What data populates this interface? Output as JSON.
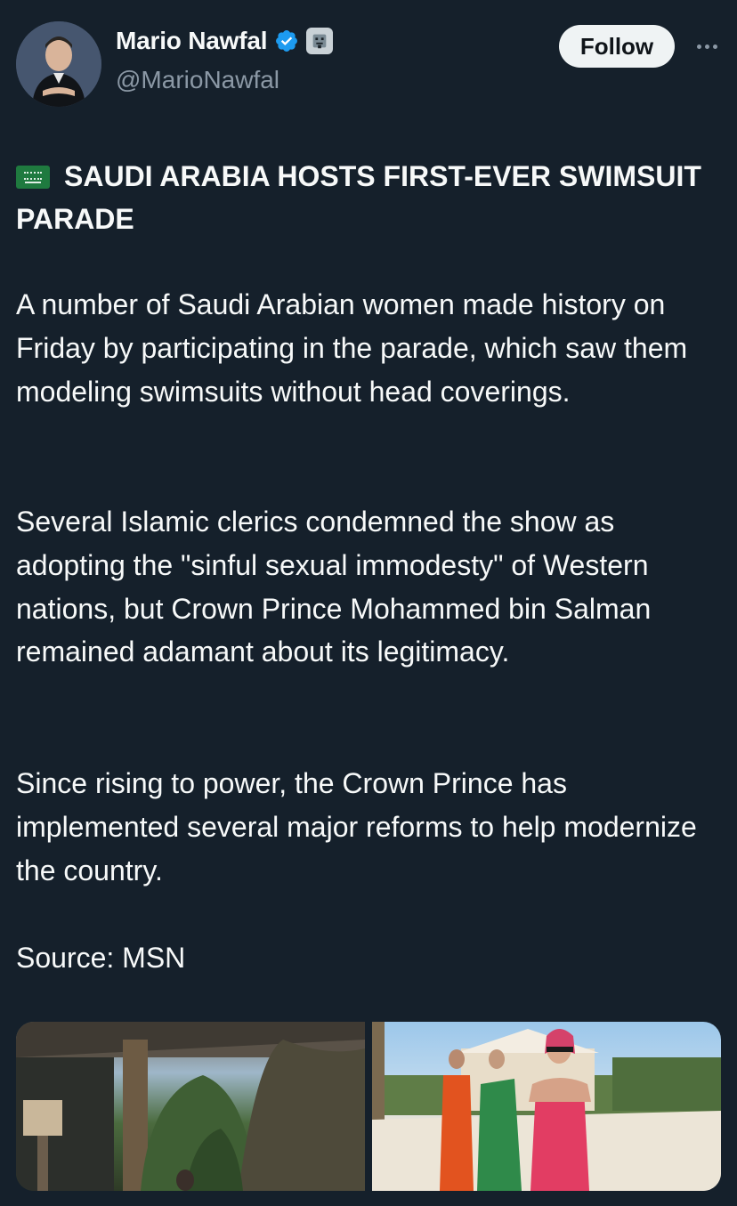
{
  "author": {
    "display_name": "Mario Nawfal",
    "handle": "@MarioNawfal",
    "verified_icon": "verified-badge-icon",
    "affiliate_icon": "robot-badge-icon"
  },
  "actions": {
    "follow_label": "Follow",
    "more_icon": "more-options-icon"
  },
  "tweet": {
    "headline": "SAUDI ARABIA HOSTS FIRST-EVER SWIMSUIT PARADE",
    "headline_icon": "saudi-flag-icon",
    "paragraphs": [
      "A number of Saudi Arabian women made history on Friday by participating in the parade, which saw them modeling swimsuits without head coverings.",
      "Several Islamic clerics condemned the show as adopting the \"sinful sexual immodesty\" of Western nations, but Crown Prince Mohammed bin Salman remained adamant about its legitimacy.",
      "Since rising to power, the Crown Prince has implemented several major reforms to help modernize the country.",
      "Source: MSN"
    ]
  },
  "media": {
    "count": 2
  },
  "colors": {
    "background": "#15202b",
    "text_primary": "#f7f9f9",
    "text_secondary": "#8b98a5",
    "verified_blue": "#1d9bf0",
    "follow_bg": "#eff3f4"
  }
}
